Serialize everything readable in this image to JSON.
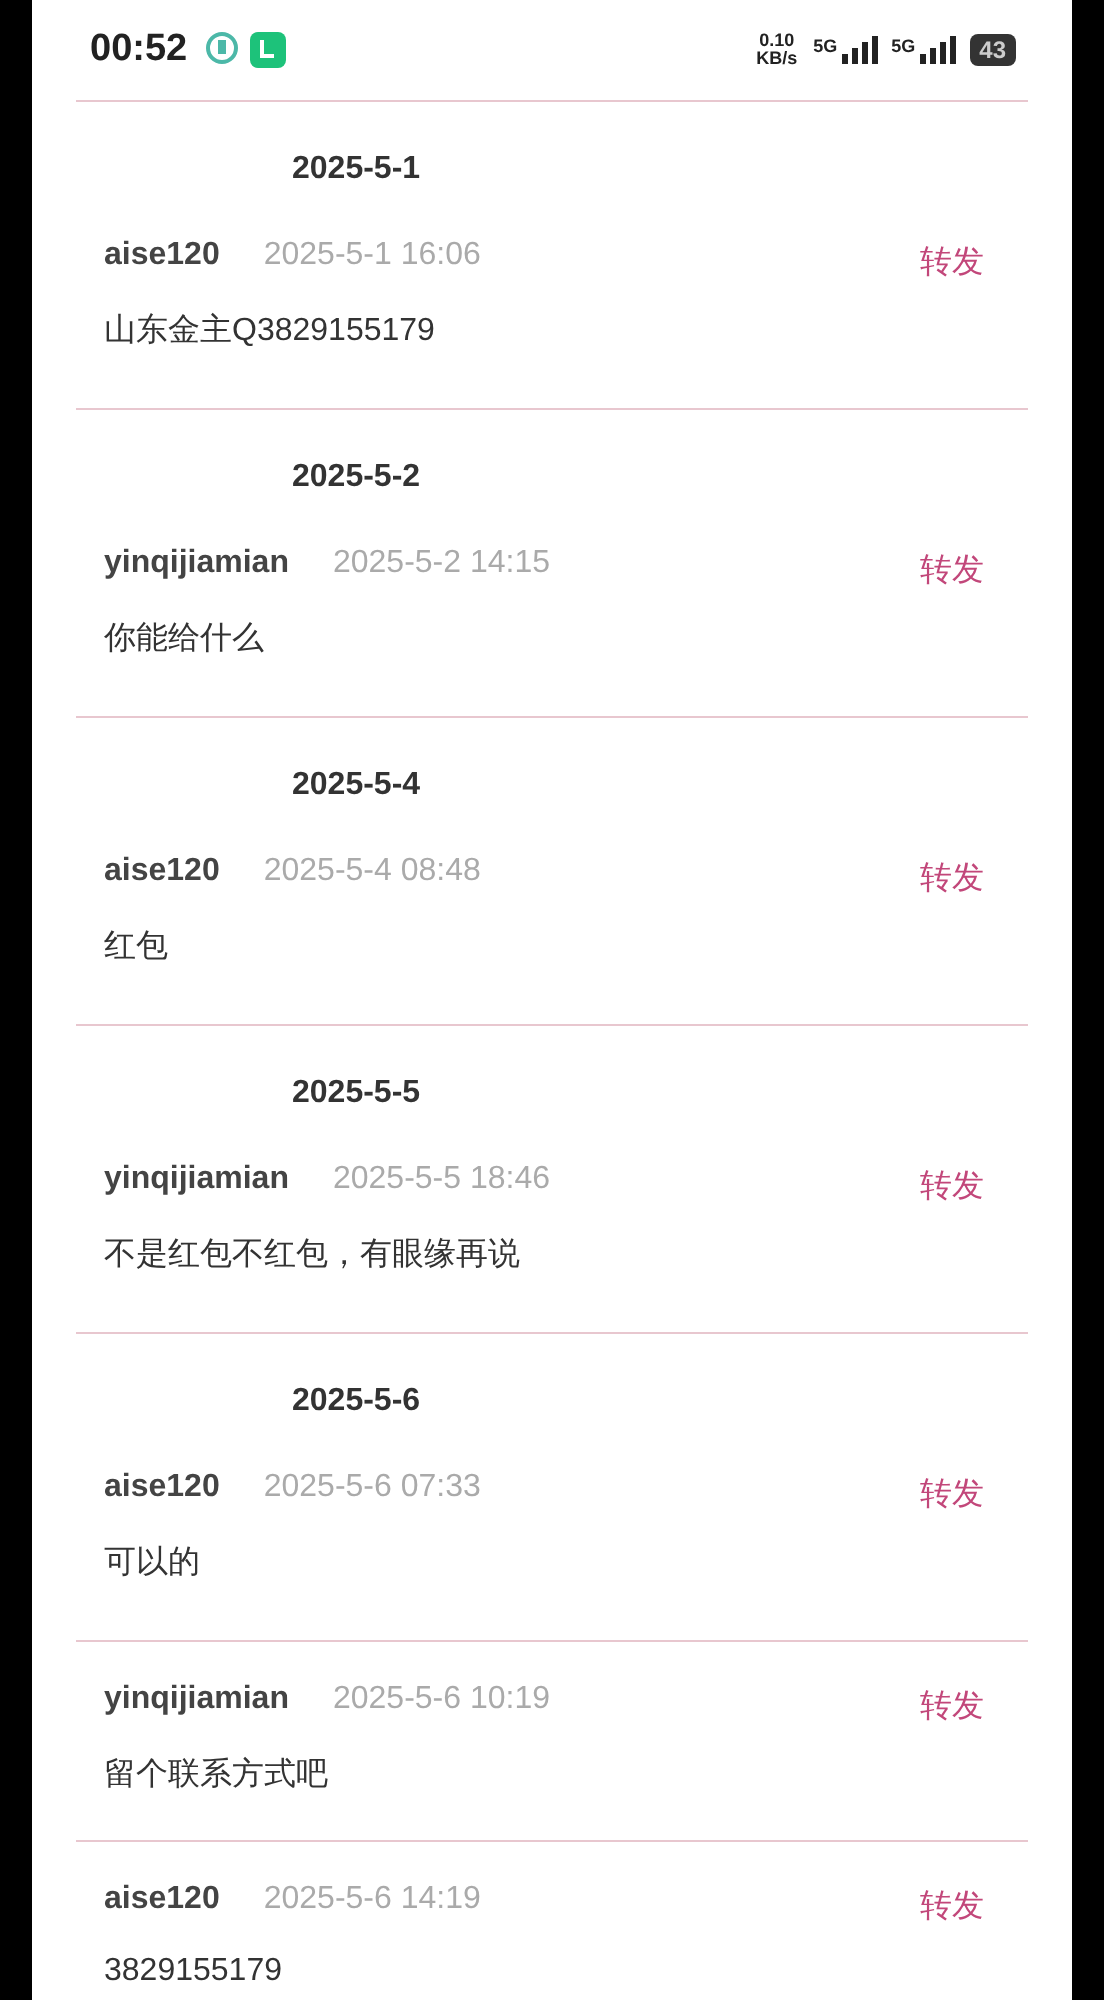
{
  "status_bar": {
    "time": "00:52",
    "net_speed": "0.10",
    "net_unit": "KB/s",
    "sims": [
      "5G",
      "5G"
    ],
    "battery": "43"
  },
  "groups": [
    {
      "date": "2025-5-1",
      "messages": [
        {
          "user": "aise120",
          "time": "2025-5-1 16:06",
          "text": "山东金主Q3829155179",
          "action": "转发"
        }
      ]
    },
    {
      "date": "2025-5-2",
      "messages": [
        {
          "user": "yinqijiamian",
          "time": "2025-5-2 14:15",
          "text": "你能给什么",
          "action": "转发"
        }
      ]
    },
    {
      "date": "2025-5-4",
      "messages": [
        {
          "user": "aise120",
          "time": "2025-5-4 08:48",
          "text": "红包",
          "action": "转发"
        }
      ]
    },
    {
      "date": "2025-5-5",
      "messages": [
        {
          "user": "yinqijiamian",
          "time": "2025-5-5 18:46",
          "text": "不是红包不红包，有眼缘再说",
          "action": "转发"
        }
      ]
    },
    {
      "date": "2025-5-6",
      "messages": [
        {
          "user": "aise120",
          "time": "2025-5-6 07:33",
          "text": "可以的",
          "action": "转发"
        },
        {
          "user": "yinqijiamian",
          "time": "2025-5-6 10:19",
          "text": "留个联系方式吧",
          "action": "转发"
        },
        {
          "user": "aise120",
          "time": "2025-5-6 14:19",
          "text": "3829155179",
          "action": "转发"
        }
      ]
    }
  ]
}
